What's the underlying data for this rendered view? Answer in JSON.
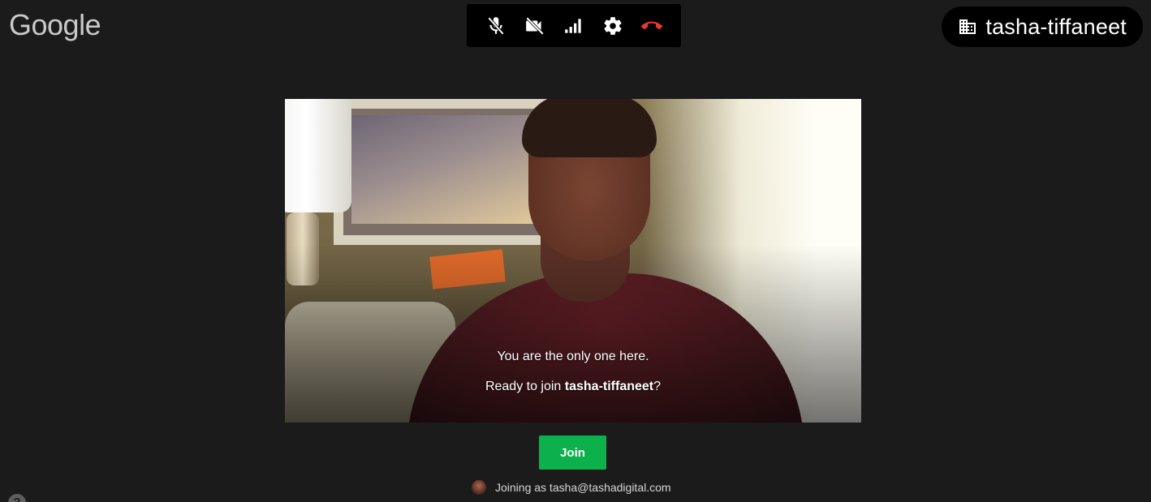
{
  "brand": {
    "logo_text": "Google"
  },
  "toolbar": {
    "buttons": [
      {
        "icon": "mic-off-icon"
      },
      {
        "icon": "video-off-icon"
      },
      {
        "icon": "signal-icon"
      },
      {
        "icon": "gear-icon"
      },
      {
        "icon": "hangup-icon",
        "color": "#e53935"
      }
    ]
  },
  "room": {
    "icon": "building-icon",
    "name": "tasha-tiffaneet"
  },
  "preview": {
    "message_line1": "You are the only one here.",
    "message_line2_prefix": "Ready to join ",
    "message_line2_room": "tasha-tiffaneet",
    "message_line2_suffix": "?"
  },
  "join": {
    "label": "Join",
    "color": "#0cb14b"
  },
  "identity": {
    "joining_text": "Joining as tasha@tashadigital.com"
  },
  "help": {
    "icon": "help-icon",
    "glyph": "?"
  },
  "colors": {
    "background": "#1b1b1b",
    "toolbar": "#000000"
  }
}
